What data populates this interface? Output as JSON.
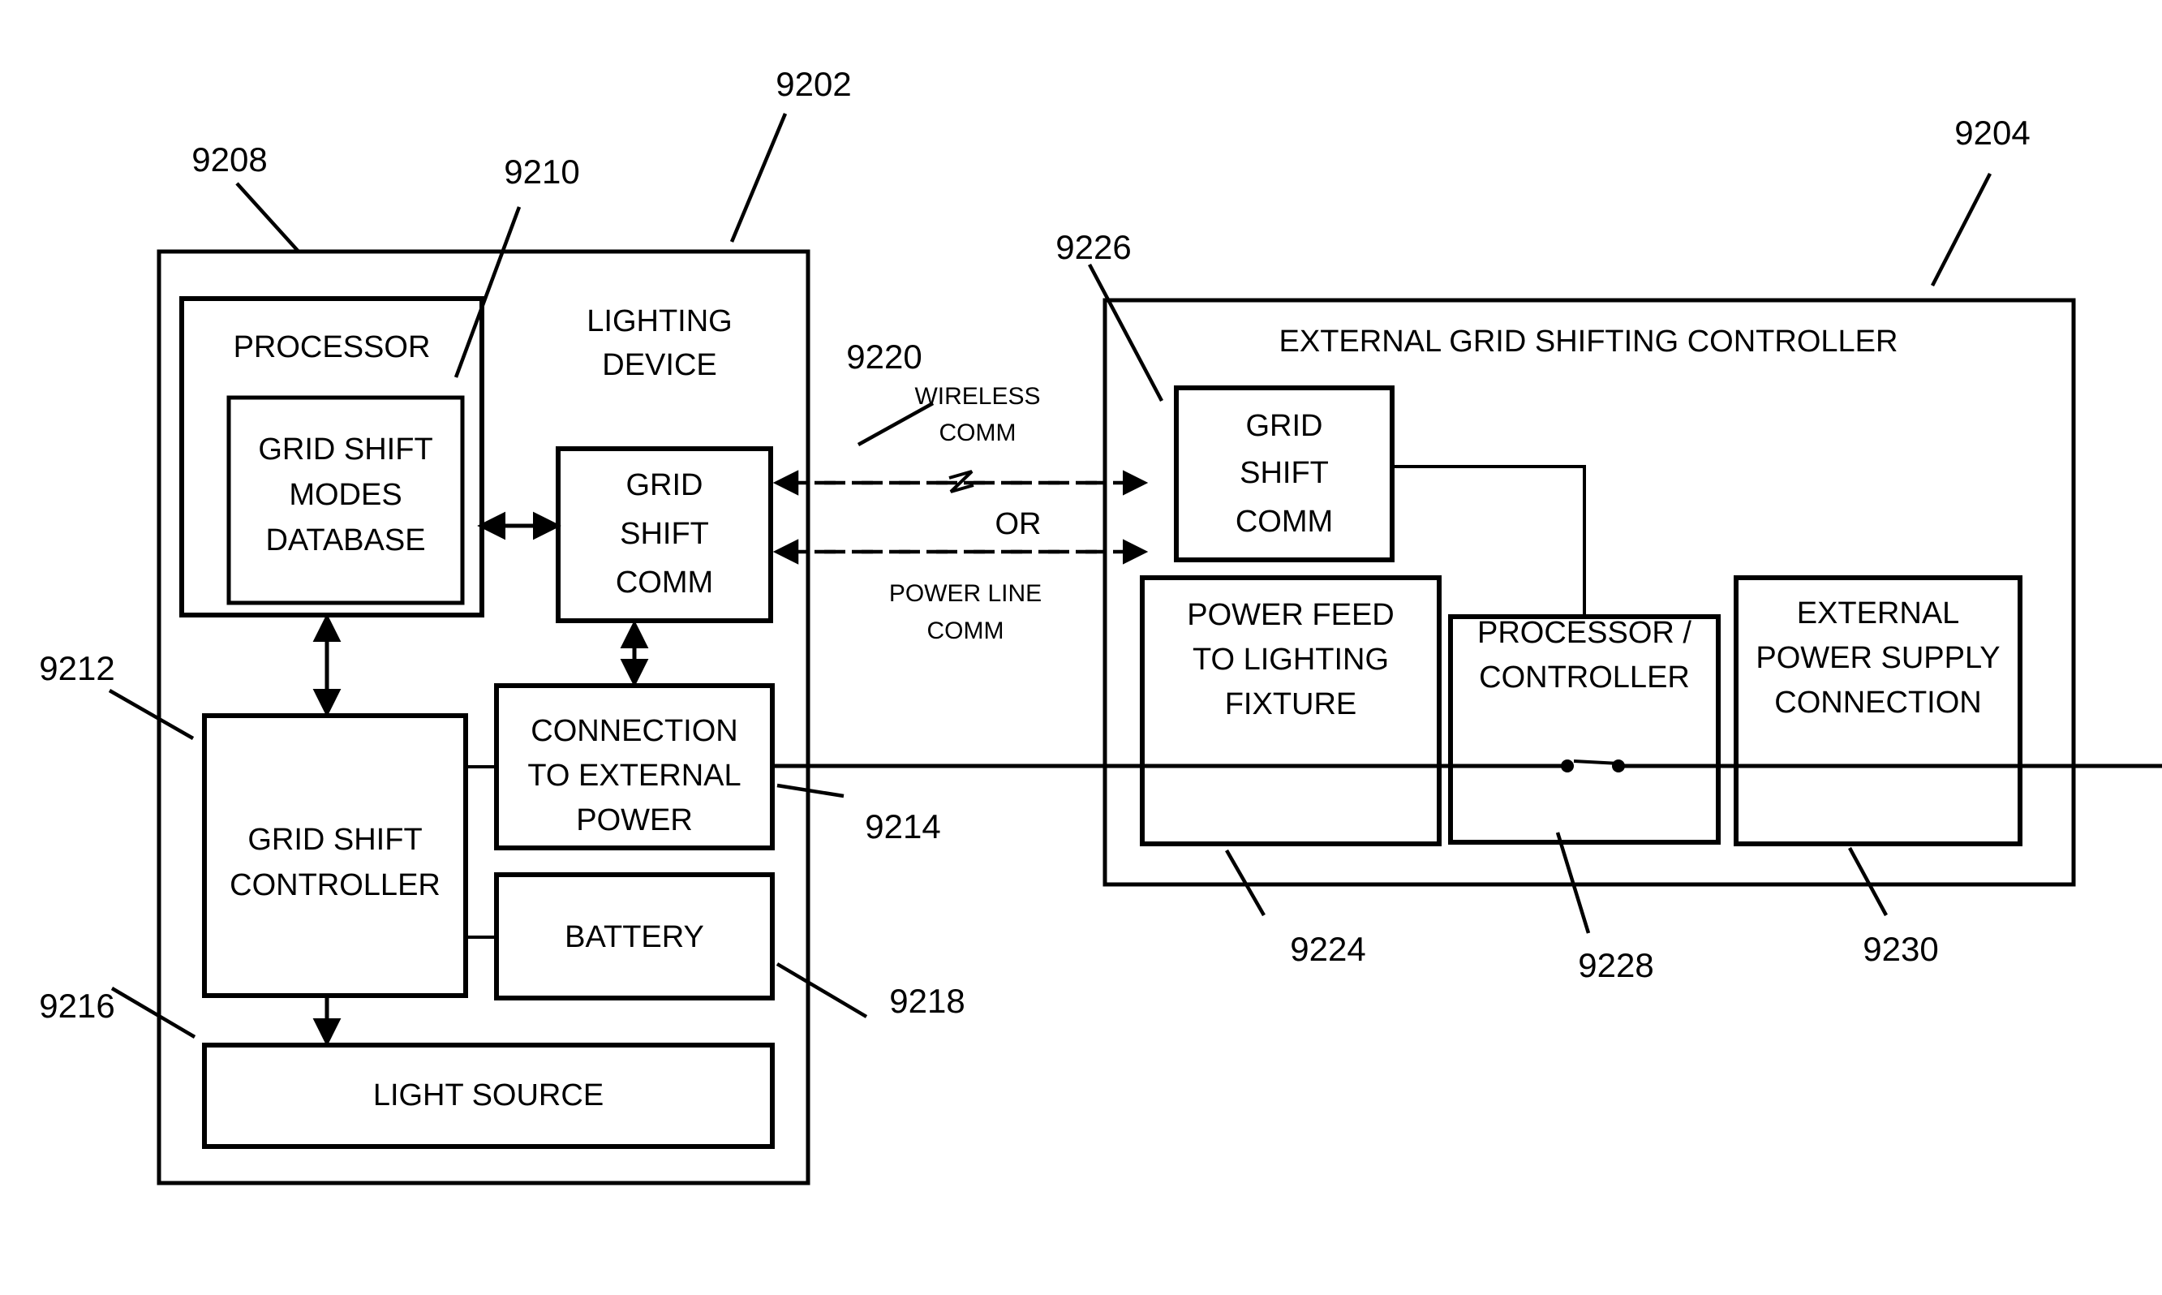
{
  "figure": {
    "title": "Lighting device and external grid shifting controller block diagram"
  },
  "left_system": {
    "ref": "9202",
    "title_line1": "LIGHTING",
    "title_line2": "DEVICE",
    "processor": {
      "ref": "9208",
      "label": "PROCESSOR",
      "database": {
        "line1": "GRID SHIFT",
        "line2": "MODES",
        "line3": "DATABASE"
      }
    },
    "grid_shift_comm": {
      "ref": "9210",
      "line1": "GRID",
      "line2": "SHIFT",
      "line3": "COMM"
    },
    "grid_shift_controller": {
      "ref": "9212",
      "line1": "GRID SHIFT",
      "line2": "CONTROLLER"
    },
    "connection_external_power": {
      "ref": "9214",
      "line1": "CONNECTION",
      "line2": "TO EXTERNAL",
      "line3": "POWER"
    },
    "battery": {
      "ref": "9218",
      "label": "BATTERY"
    },
    "light_source": {
      "ref": "9216",
      "label": "LIGHT SOURCE"
    }
  },
  "comm_link": {
    "ref": "9220",
    "wireless_line1": "WIRELESS",
    "wireless_line2": "COMM",
    "or_label": "OR",
    "powerline_line1": "POWER LINE",
    "powerline_line2": "COMM"
  },
  "right_system": {
    "ref": "9204",
    "title": "EXTERNAL GRID SHIFTING CONTROLLER",
    "grid_shift_comm": {
      "ref": "9226",
      "line1": "GRID",
      "line2": "SHIFT",
      "line3": "COMM"
    },
    "power_feed": {
      "ref": "9224",
      "line1": "POWER FEED",
      "line2": "TO LIGHTING",
      "line3": "FIXTURE"
    },
    "processor_controller": {
      "ref": "9228",
      "line1": "PROCESSOR /",
      "line2": "CONTROLLER"
    },
    "external_power_supply": {
      "ref": "9230",
      "line1": "EXTERNAL",
      "line2": "POWER SUPPLY",
      "line3": "CONNECTION"
    }
  },
  "colors": {
    "stroke": "#000000",
    "background": "#ffffff"
  }
}
